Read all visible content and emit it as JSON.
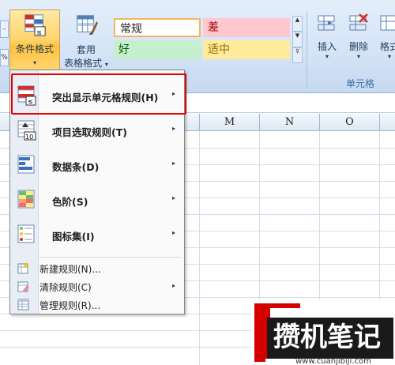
{
  "ribbon": {
    "left_small_buttons": [
      "-",
      "%"
    ],
    "conditional_format": {
      "label": "条件格式",
      "arrow": "▾"
    },
    "table_format": {
      "label_line1": "套用",
      "label_line2": "表格格式",
      "arrow": "▾"
    },
    "styles": {
      "normal": "常规",
      "bad": "差",
      "good": "好",
      "neutral": "适中"
    },
    "cells": {
      "insert": {
        "label": "插入",
        "arrow": "▾"
      },
      "delete": {
        "label": "删除",
        "arrow": "▾"
      },
      "format": {
        "label": "格式",
        "arrow": "▾"
      },
      "group_label": "单元格"
    }
  },
  "sheet": {
    "columns": [
      "M",
      "N",
      "O"
    ]
  },
  "menu": {
    "items": [
      {
        "label": "突出显示单元格规则(H)",
        "icon": "highlight-cells-rules-icon",
        "submenu": true
      },
      {
        "label": "项目选取规则(T)",
        "icon": "top-bottom-rules-icon",
        "submenu": true
      },
      {
        "label": "数据条(D)",
        "icon": "data-bars-icon",
        "submenu": true
      },
      {
        "label": "色阶(S)",
        "icon": "color-scales-icon",
        "submenu": true
      },
      {
        "label": "图标集(I)",
        "icon": "icon-sets-icon",
        "submenu": true
      }
    ],
    "small_items": [
      {
        "label": "新建规则(N)...",
        "icon": "new-rule-icon",
        "submenu": false
      },
      {
        "label": "清除规则(C)",
        "icon": "clear-rules-icon",
        "submenu": true
      },
      {
        "label": "管理规则(R)...",
        "icon": "manage-rules-icon",
        "submenu": false
      }
    ],
    "submenu_arrow": "▸"
  },
  "watermark": {
    "title": "攒机笔记",
    "url": "www.cuanjibiji.com"
  },
  "colors": {
    "highlight_border": "#e60000",
    "ribbon_bg": "#d5e4f7",
    "watermark_red": "#d40000"
  }
}
